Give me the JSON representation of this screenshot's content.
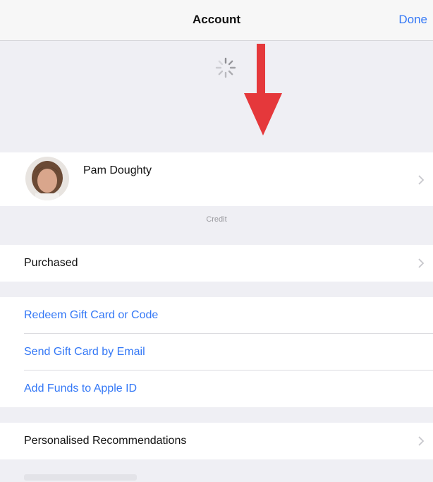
{
  "nav": {
    "title": "Account",
    "done_label": "Done"
  },
  "profile": {
    "name": "Pam Doughty",
    "credit_label": "Credit"
  },
  "menu": {
    "purchased": "Purchased",
    "redeem": "Redeem Gift Card or Code",
    "send_gift": "Send Gift Card by Email",
    "add_funds": "Add Funds to Apple ID",
    "recommendations": "Personalised Recommendations"
  },
  "colors": {
    "accent": "#3478f6",
    "annotation_arrow": "#e5383b",
    "background": "#efeff4"
  },
  "icons": {
    "spinner": "loading-spinner-icon",
    "chevron": "chevron-right-icon",
    "arrow": "red-down-arrow-icon"
  }
}
